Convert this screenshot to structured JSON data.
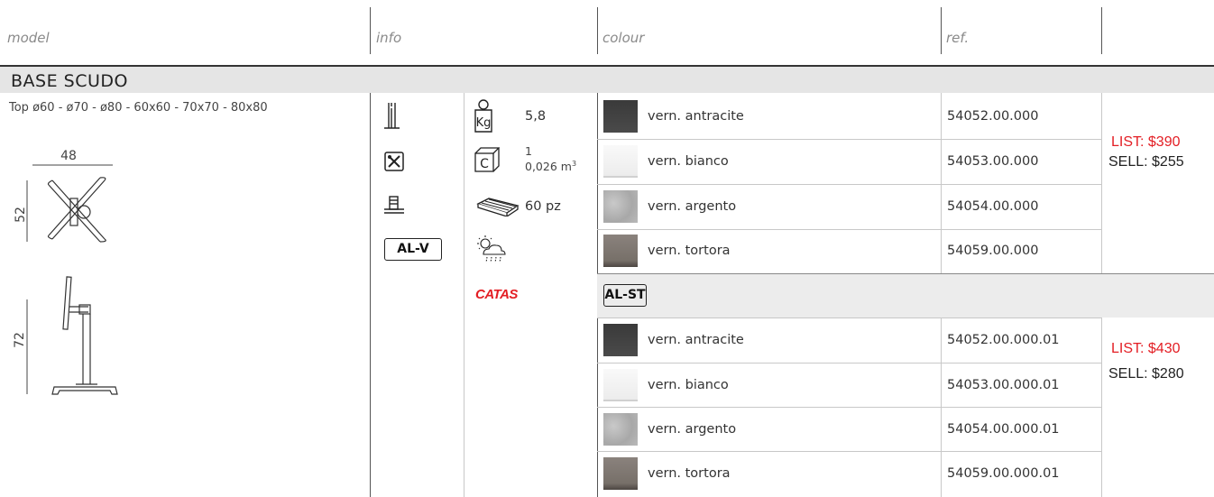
{
  "header": {
    "model": "model",
    "info": "info",
    "colour": "colour",
    "ref": "ref."
  },
  "section_title": "BASE SCUDO",
  "model": {
    "top_sizes": "Top  ø60 - ø70 - ø80 - 60x60 - 70x70 - 80x80",
    "dims": {
      "width": "48",
      "depth": "52",
      "height": "72"
    }
  },
  "info": {
    "weight": "5,8",
    "carton_count": "1",
    "carton_volume": "0,026 m",
    "carton_volume_sup": "3",
    "pallet": "60 pz",
    "material_badge": "AL-V",
    "catas_logo": "CATAS",
    "icons": [
      "height-adjust-icon",
      "tools-icon",
      "base-icon",
      "weight-icon",
      "carton-icon",
      "pallet-icon",
      "weather-icon",
      "catas-icon"
    ]
  },
  "group_a": {
    "rows": [
      {
        "colour": "vern. antracite",
        "ref": "54052.00.000",
        "swatch": "#404040"
      },
      {
        "colour": "vern. bianco",
        "ref": "54053.00.000",
        "swatch": "#f2f2f2"
      },
      {
        "colour": "vern. argento",
        "ref": "54054.00.000",
        "swatch": "#b5b5b5"
      },
      {
        "colour": "vern. tortora",
        "ref": "54059.00.000",
        "swatch": "#7d756f"
      }
    ],
    "list_price": "LIST: $390",
    "sell_price": "SELL: $255"
  },
  "group_b": {
    "badge": "AL-ST",
    "rows": [
      {
        "colour": "vern. antracite",
        "ref": "54052.00.000.01",
        "swatch": "#404040"
      },
      {
        "colour": "vern. bianco",
        "ref": "54053.00.000.01",
        "swatch": "#f2f2f2"
      },
      {
        "colour": "vern. argento",
        "ref": "54054.00.000.01",
        "swatch": "#b5b5b5"
      },
      {
        "colour": "vern. tortora",
        "ref": "54059.00.000.01",
        "swatch": "#7d756f"
      }
    ],
    "list_price": "LIST: $430",
    "sell_price": "SELL: $280"
  },
  "colors": {
    "list_price": "#e31e24",
    "catas": "#e31e24",
    "title_bar": "#e5e5e5"
  }
}
